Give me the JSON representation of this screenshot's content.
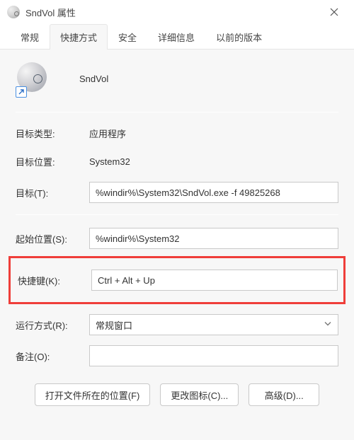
{
  "window": {
    "title": "SndVol 属性"
  },
  "tabs": {
    "general": "常规",
    "shortcut": "快捷方式",
    "security": "安全",
    "details": "详细信息",
    "previous": "以前的版本",
    "active": "shortcut"
  },
  "header": {
    "app_name": "SndVol"
  },
  "fields": {
    "target_type_label": "目标类型:",
    "target_type_value": "应用程序",
    "target_location_label": "目标位置:",
    "target_location_value": "System32",
    "target_label": "目标(T):",
    "target_value": "%windir%\\System32\\SndVol.exe -f 49825268",
    "start_in_label": "起始位置(S):",
    "start_in_value": "%windir%\\System32",
    "hotkey_label": "快捷键(K):",
    "hotkey_value": "Ctrl + Alt + Up",
    "run_label": "运行方式(R):",
    "run_value": "常规窗口",
    "comment_label": "备注(O):",
    "comment_value": ""
  },
  "buttons": {
    "open_location": "打开文件所在的位置(F)",
    "change_icon": "更改图标(C)...",
    "advanced": "高级(D)..."
  }
}
